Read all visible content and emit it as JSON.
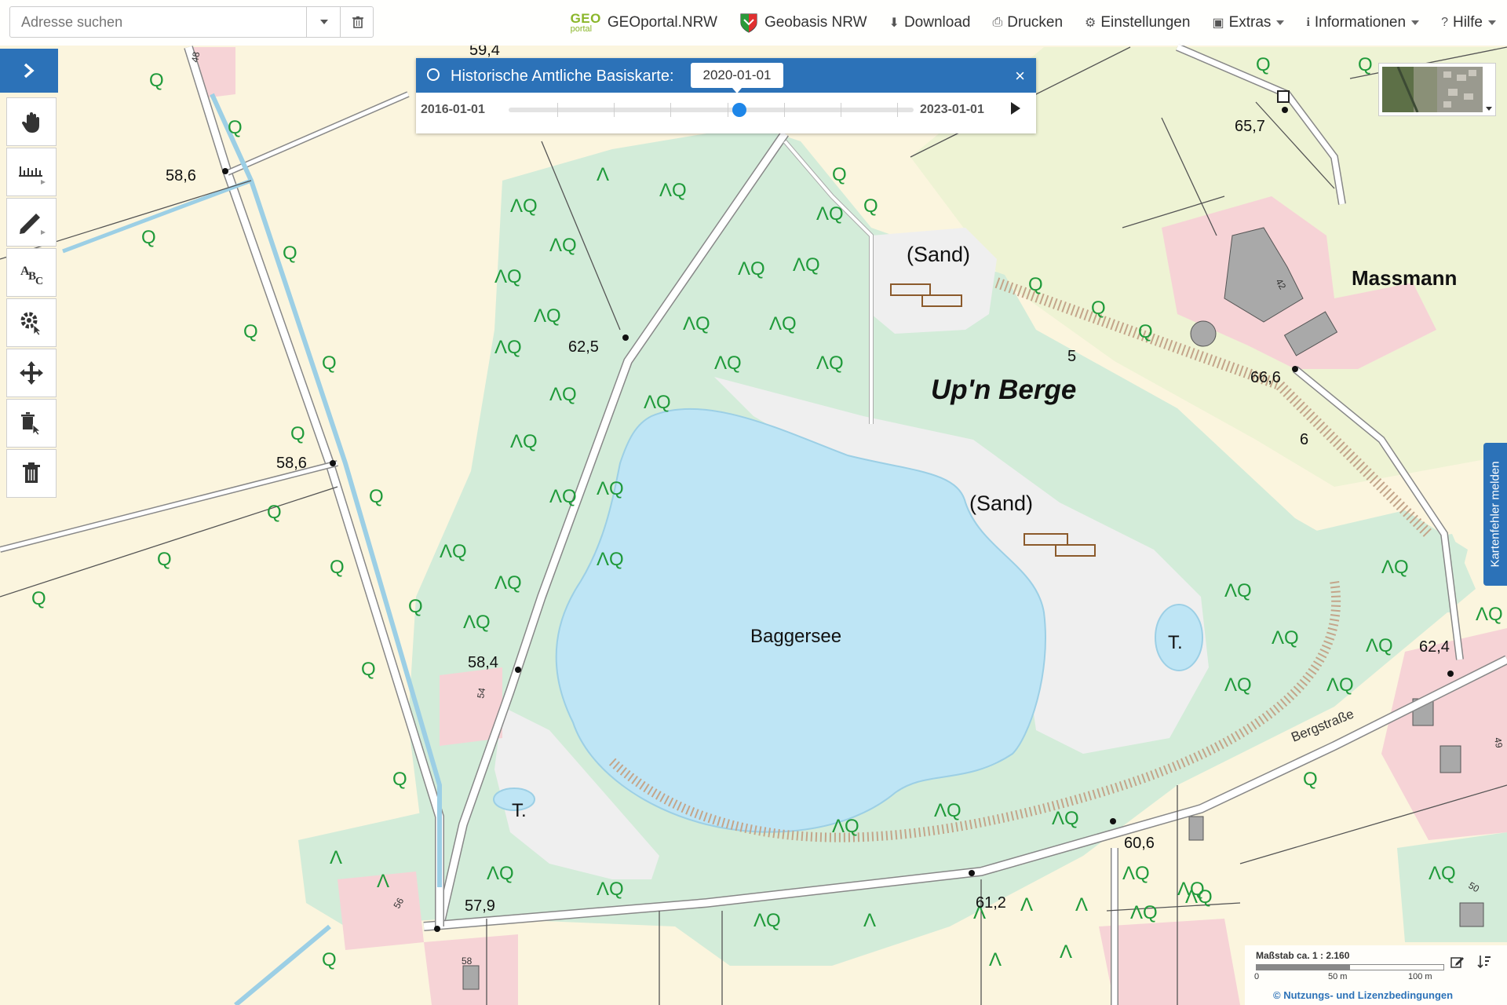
{
  "search": {
    "placeholder": "Adresse suchen"
  },
  "menu": {
    "geo_brand": "GEO",
    "geo_portal_word": "portal",
    "geoportal": "GEOportal.NRW",
    "geobasis": "Geobasis NRW",
    "download": "Download",
    "print": "Drucken",
    "settings": "Einstellungen",
    "extras": "Extras",
    "info": "Informationen",
    "help": "Hilfe"
  },
  "timeline": {
    "title": "Historische Amtliche Basiskarte:",
    "selected": "2020-01-01",
    "start": "2016-01-01",
    "end": "2023-01-01",
    "position": 0.57,
    "close": "×"
  },
  "side_tab": "Kartenfehler melden",
  "scale": {
    "label": "Maßstab ca. 1 : 2.160",
    "t0": "0",
    "t1": "50 m",
    "t2": "100 m",
    "license": "© Nutzungs- und Lizenzbedingungen"
  },
  "map_labels": {
    "baggersee": "Baggersee",
    "upn_berge": "Up'n Berge",
    "massmann": "Massmann",
    "sand1": "(Sand)",
    "sand2": "(Sand)",
    "t1": "T.",
    "t2": "T.",
    "bergstrasse": "Bergstraße",
    "e594": "59,4",
    "e586a": "58,6",
    "e586b": "58,6",
    "e625": "62,5",
    "e584": "58,4",
    "e579": "57,9",
    "e612": "61,2",
    "e606": "60,6",
    "e624": "62,4",
    "e666": "66,6",
    "e657": "65,7",
    "n5": "5",
    "n6": "6",
    "h48": "48",
    "h54": "54",
    "h56": "56",
    "h58": "58",
    "h42": "42",
    "h49": "49",
    "h50": "50"
  },
  "colors": {
    "accent": "#2c72b8",
    "water": "#bee5f5",
    "forest": "#d3ecd9",
    "field": "#fbf5de",
    "meadow": "#eef3d4",
    "sand": "#efefef",
    "settlement": "#f6d3d6"
  }
}
